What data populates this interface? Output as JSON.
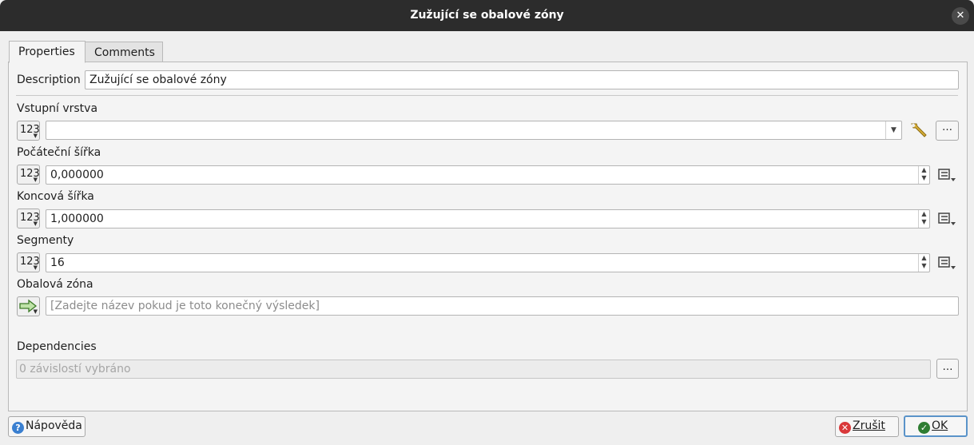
{
  "window": {
    "title": "Zužující se obalové zóny",
    "close_glyph": "✕"
  },
  "tabs": [
    {
      "label": "Properties",
      "active": true
    },
    {
      "label": "Comments",
      "active": false
    }
  ],
  "description": {
    "label": "Description",
    "value": "Zužující se obalové zóny"
  },
  "params": {
    "input_layer": {
      "label": "Vstupní vrstva",
      "badge": "123",
      "value": "",
      "more_label": "…"
    },
    "start_width": {
      "label": "Počáteční šířka",
      "badge": "123",
      "value": "0,000000"
    },
    "end_width": {
      "label": "Koncová šířka",
      "badge": "123",
      "value": "1,000000"
    },
    "segments": {
      "label": "Segmenty",
      "badge": "123",
      "value": "16"
    },
    "output": {
      "label": "Obalová zóna",
      "placeholder": "[Zadejte název pokud je toto konečný výsledek]"
    }
  },
  "dependencies": {
    "label": "Dependencies",
    "value": "0 závislostí vybráno",
    "button_label": "…"
  },
  "buttons": {
    "help": {
      "label": "Nápověda",
      "icon": "?"
    },
    "cancel": {
      "label": "Zrušit",
      "icon": "✕"
    },
    "ok": {
      "label": "OK",
      "icon": "✓"
    }
  },
  "colors": {
    "accent": "#5a93c9",
    "titlebar": "#2c2c2c",
    "cancel_icon": "#d9383a",
    "ok_icon": "#2e7d32",
    "help_icon": "#3a7fd0"
  }
}
